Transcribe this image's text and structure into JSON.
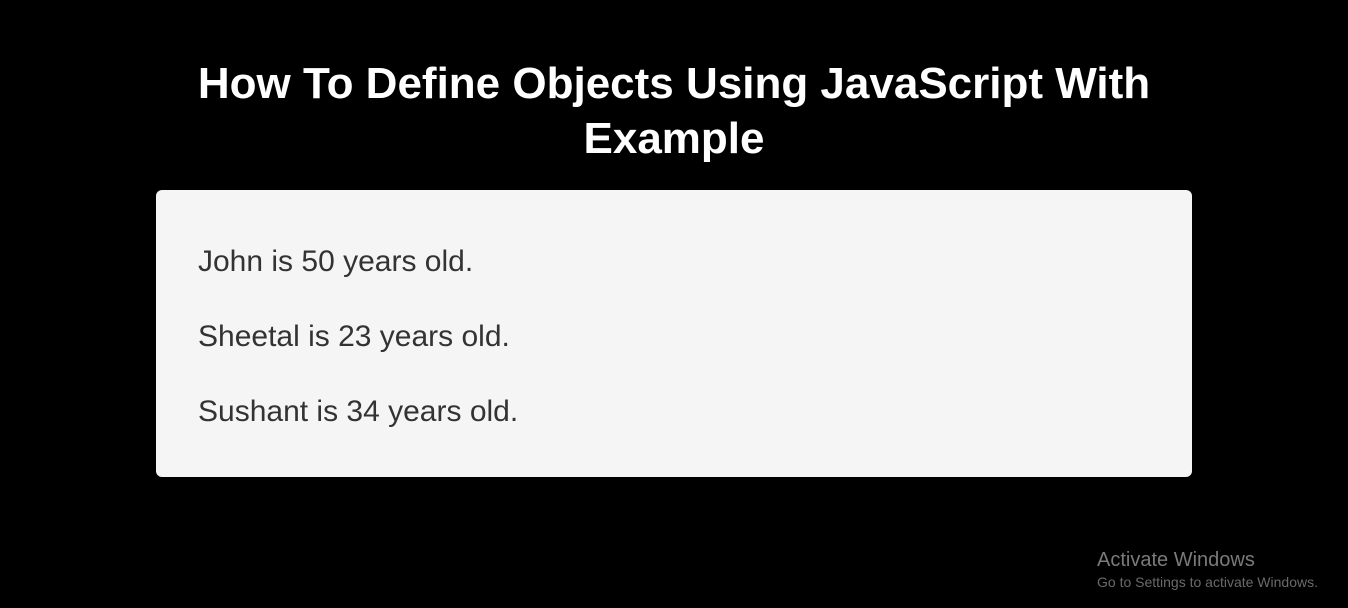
{
  "title": "How To Define Objects Using JavaScript With Example",
  "entries": [
    "John is 50 years old.",
    "Sheetal is 23 years old.",
    "Sushant is 34 years old."
  ],
  "watermark": {
    "title": "Activate Windows",
    "sub": "Go to Settings to activate Windows."
  }
}
